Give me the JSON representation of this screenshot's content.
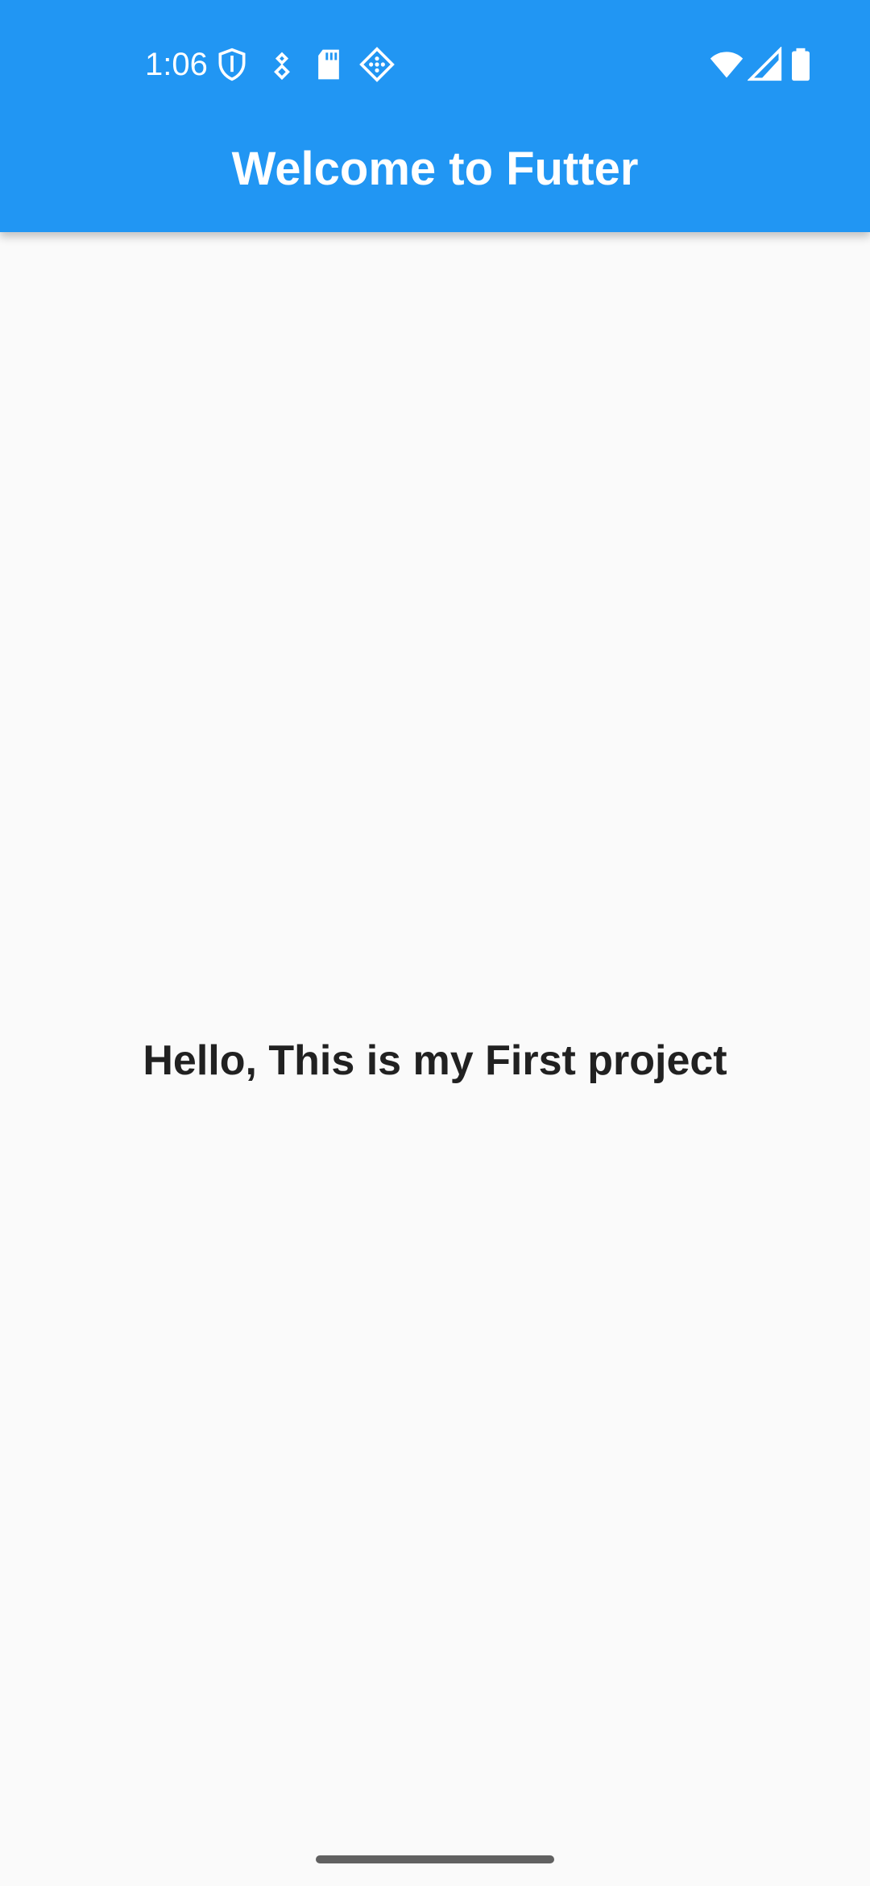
{
  "status_bar": {
    "time": "1:06",
    "left_icons": [
      "shield-icon",
      "location-pin-icon",
      "sd-card-icon",
      "diamond-grid-icon"
    ],
    "right_icons": [
      "wifi-icon",
      "cellular-signal-icon",
      "battery-icon"
    ]
  },
  "app_bar": {
    "title": "Welcome to Futter",
    "color": "#2196f3"
  },
  "main": {
    "message": "Hello, This is my First project"
  },
  "colors": {
    "background": "#fafafa",
    "text": "#212121",
    "accent": "#2196f3"
  }
}
